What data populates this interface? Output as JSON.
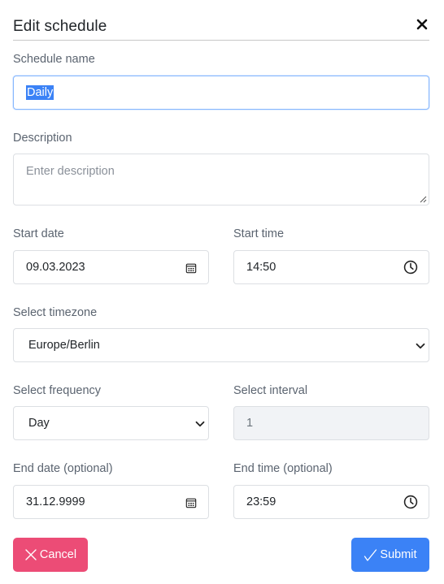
{
  "dialog": {
    "title": "Edit schedule"
  },
  "schedule_name": {
    "label": "Schedule name",
    "value": "Daily"
  },
  "description": {
    "label": "Description",
    "placeholder": "Enter description"
  },
  "start_date": {
    "label": "Start date",
    "value": "09.03.2023"
  },
  "start_time": {
    "label": "Start time",
    "value": "14:50"
  },
  "timezone": {
    "label": "Select timezone",
    "value": "Europe/Berlin"
  },
  "frequency": {
    "label": "Select frequency",
    "value": "Day"
  },
  "interval": {
    "label": "Select interval",
    "value": "1"
  },
  "end_date": {
    "label": "End date (optional)",
    "value": "31.12.9999"
  },
  "end_time": {
    "label": "End time (optional)",
    "value": "23:59"
  },
  "buttons": {
    "cancel": "Cancel",
    "submit": "Submit"
  },
  "colors": {
    "cancel": "#ec4c76",
    "submit": "#3b82f6",
    "selection": "#3b82f6"
  },
  "icons": {
    "close": "close-icon",
    "calendar": "calendar-icon",
    "clock": "clock-icon",
    "chevron": "chevron-down-icon",
    "cancel": "x-icon",
    "submit": "check-icon"
  }
}
